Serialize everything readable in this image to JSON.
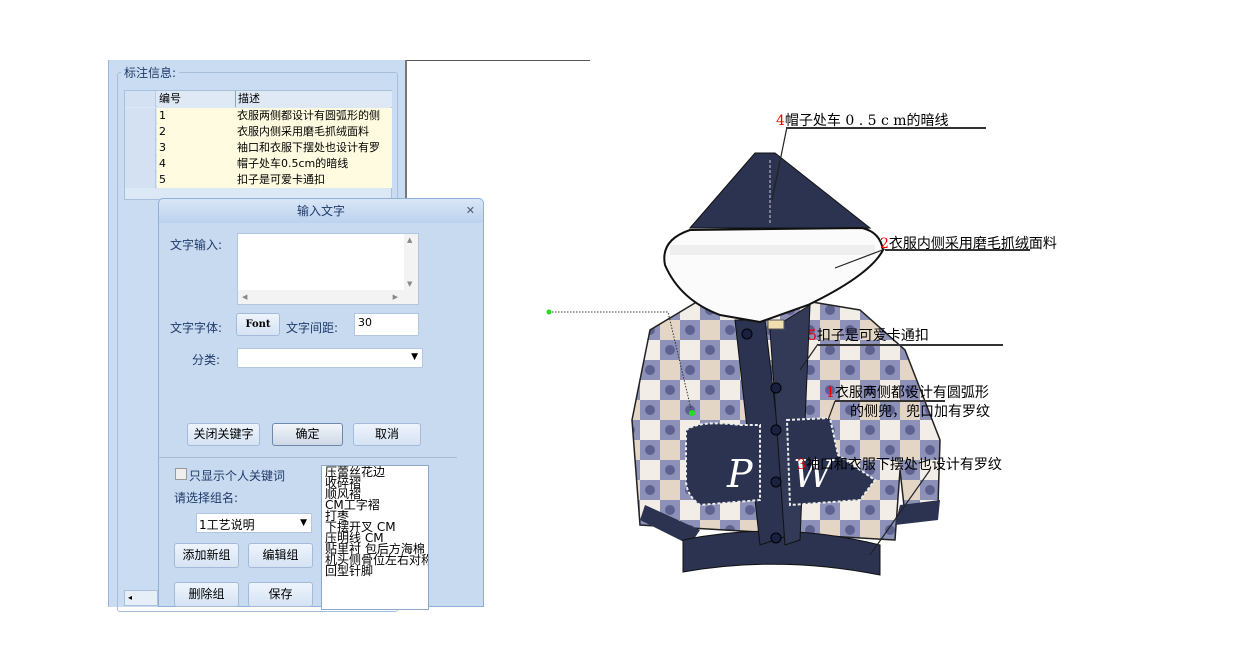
{
  "panel": {
    "group_label": "标注信息:",
    "table": {
      "columns": [
        "编号",
        "描述"
      ],
      "rows": [
        {
          "num": "1",
          "desc": "衣服两侧都设计有圆弧形的侧"
        },
        {
          "num": "2",
          "desc": "衣服内侧采用磨毛抓绒面料"
        },
        {
          "num": "3",
          "desc": "袖口和衣服下摆处也设计有罗"
        },
        {
          "num": "4",
          "desc": "帽子处车0.5cm的暗线"
        },
        {
          "num": "5",
          "desc": "扣子是可爱卡通扣"
        }
      ]
    }
  },
  "dialog": {
    "title": "输入文字",
    "close_icon": "close-icon",
    "text_input_label": "文字输入:",
    "text_input_value": "",
    "font_label": "文字字体:",
    "font_button": "Font",
    "spacing_label": "文字间距:",
    "spacing_value": "30",
    "category_label": "分类:",
    "category_value": "",
    "close_keywords_button": "关闭关键字",
    "ok_button": "确定",
    "cancel_button": "取消",
    "personal_only_label": "只显示个人关键词",
    "personal_only_checked": false,
    "group_select_label": "请选择组名:",
    "group_select_value": "1工艺说明",
    "add_group_button": "添加新组",
    "edit_group_button": "编辑组",
    "delete_group_button": "删除组",
    "save_button": "保存",
    "keywords": [
      "压蕾丝花边",
      "收碎褶",
      "顺风褶",
      "CM工字褶",
      "打枣",
      "下摆开叉 CM",
      "压明线 CM",
      "贴里衬 包后方海棉",
      "机头侧骨位左右对称",
      "回型针脚"
    ]
  },
  "annotations": [
    {
      "num": "4",
      "text": "帽子处车 0 . 5 c m的暗线"
    },
    {
      "num": "2",
      "text": "衣服内侧采用磨毛抓绒面料"
    },
    {
      "num": "5",
      "text": "扣子是可爱卡通扣"
    },
    {
      "num": "1",
      "text": "衣服两侧都设计有圆弧形",
      "text2": "的侧兜，兜口加有罗纹"
    },
    {
      "num": "3",
      "text": "袖口和衣服下摆处也设计有罗纹"
    }
  ],
  "jacket_letters": [
    "P",
    "W"
  ],
  "colors": {
    "panel": "#cadcf1",
    "navy": "#2b3350",
    "annotation_number": "#ee0000",
    "row_bg": "#fffbe0"
  }
}
